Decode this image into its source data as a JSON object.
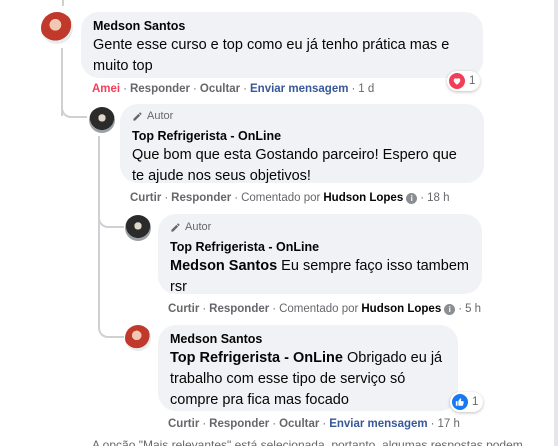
{
  "comments": [
    {
      "name": "Medson Santos",
      "text": "Gente esse curso e top como eu já tenho prática mas e muito top",
      "actions": {
        "like": "Amei",
        "reply": "Responder",
        "hide": "Ocultar",
        "message": "Enviar mensagem",
        "time": "1 d"
      },
      "reaction": {
        "type": "love",
        "count": "1"
      }
    },
    {
      "badge": "Autor",
      "name": "Top Refrigerista - OnLine",
      "text": "Que bom que esta Gostando parceiro! Espero que te ajude nos seus objetivos!",
      "actions": {
        "like": "Curtir",
        "reply": "Responder",
        "commented_by_label": "Comentado por",
        "commented_by": "Hudson Lopes",
        "time": "18 h"
      }
    },
    {
      "badge": "Autor",
      "name": "Top Refrigerista - OnLine",
      "mention": "Medson Santos",
      "text": " Eu sempre faço isso tambem rsr",
      "actions": {
        "like": "Curtir",
        "reply": "Responder",
        "commented_by_label": "Comentado por",
        "commented_by": "Hudson Lopes",
        "time": "5 h"
      }
    },
    {
      "name": "Medson Santos",
      "mention": "Top Refrigerista - OnLine",
      "text": " Obrigado eu já trabalho com esse tipo de serviço só compre pra fica mas focado",
      "actions": {
        "like": "Curtir",
        "reply": "Responder",
        "hide": "Ocultar",
        "message": "Enviar mensagem",
        "time": "17 h"
      },
      "reaction": {
        "type": "like",
        "count": "1"
      }
    }
  ],
  "separator": "·",
  "info_glyph": "i",
  "footer": "A opção \"Mais relevantes\" está selecionada, portanto, algumas respostas podem",
  "colors": {
    "bubble": "#f0f2f5",
    "meta": "#65676b",
    "love": "#f33e58",
    "link": "#385898",
    "like": "#1877f2"
  },
  "icons": [
    "pencil-icon",
    "heart-icon",
    "thumbs-up-icon",
    "info-icon"
  ]
}
